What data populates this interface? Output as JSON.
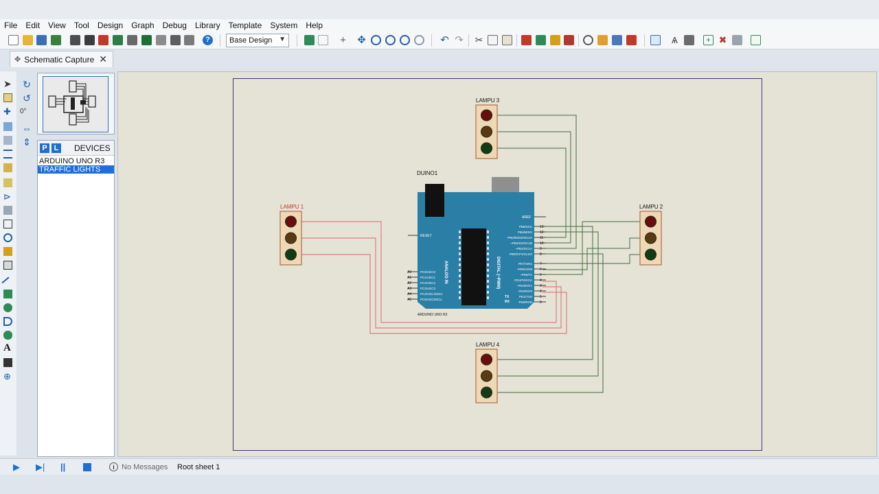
{
  "menu": [
    "File",
    "Edit",
    "View",
    "Tool",
    "Design",
    "Graph",
    "Debug",
    "Library",
    "Template",
    "System",
    "Help"
  ],
  "toolbar": {
    "design_select": "Base Design"
  },
  "tab": {
    "label": "Schematic Capture",
    "close": "✕"
  },
  "left_tools": {
    "rotation_value": "0°"
  },
  "devices": {
    "p_label": "P",
    "l_label": "L",
    "title": "DEVICES",
    "items": [
      "ARDUINO UNO R3",
      "TRAFFIC LIGHTS"
    ],
    "selected_index": 1
  },
  "schematic": {
    "lampu1": "LAMPU 1",
    "lampu2": "LAMPU 2",
    "lampu3": "LAMPU 3",
    "lampu4": "LAMPU 4",
    "board_ref": "DUINO1",
    "board_name": "ARDUINO UNO R3",
    "reset_label": "RESET",
    "aref_label": "AREF",
    "analog_label": "ANALOG IN",
    "digital_label": "DIGITAL (~PWM)",
    "tx_label": "TX",
    "rx_label": "RX",
    "analog_pins": [
      "A0",
      "A1",
      "A2",
      "A3",
      "A4",
      "A5"
    ],
    "analog_port_names": [
      "PC0/ADC0",
      "PC1/ADC1",
      "PC2/ADC2",
      "PC3/ADC3",
      "PC4/ADC4/SDA",
      "PC5/ADC5/SCL"
    ],
    "digital_pins": [
      "13",
      "12",
      "11",
      "10",
      "9",
      "8",
      "7",
      "6",
      "5",
      "4",
      "3",
      "2",
      "1",
      "0"
    ],
    "digital_port_names": [
      "PB5/SCK",
      "PB4/MISO",
      "~PB3/MOSI/OC2A",
      "~PB2/SS/OC1B",
      "~PB1/OC1A",
      "PB0/ICP1/CLKO",
      "PD7/AIN1",
      "~PD6/AIN0",
      "~PD5/T1",
      "PD4/T0/XCK",
      "~PD3/INT1",
      "PD2/INT0",
      "PD1/TXD",
      "PD0/RXD"
    ],
    "colors": {
      "wire_lampu1": "#d98080",
      "wire_green": "#3f6e3f",
      "board": "#2a7fa6",
      "lamp_body": "#efd9b5",
      "lamp_border": "#b06c4c"
    }
  },
  "status": {
    "message": "No Messages",
    "sheet": "Root sheet 1"
  }
}
